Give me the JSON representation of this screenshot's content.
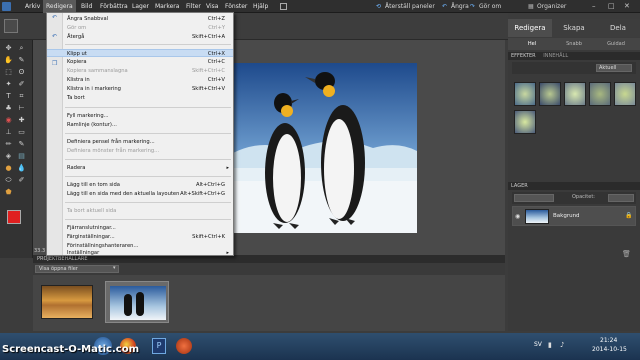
{
  "menubar": {
    "items": [
      "Arkiv",
      "Redigera",
      "Bild",
      "Förbättra",
      "Lager",
      "Markera",
      "Filter",
      "Visa",
      "Fönster",
      "Hjälp"
    ],
    "active_index": 1,
    "reset_panels": "Återställ paneler",
    "undo": "Ångra",
    "redo": "Gör om",
    "organizer": "Organizer"
  },
  "panel_tabs": [
    "Redigera",
    "Skapa",
    "Dela"
  ],
  "sub_tabs": [
    "Hel",
    "Snabb",
    "Guidad"
  ],
  "edit_menu": [
    {
      "label": "Ångra Snabbval",
      "shortcut": "Ctrl+Z",
      "disabled": false
    },
    {
      "label": "Gör om",
      "shortcut": "Ctrl+Y",
      "disabled": true
    },
    {
      "label": "Återgå",
      "shortcut": "Skift+Ctrl+A",
      "disabled": false
    },
    {
      "label": "Klipp ut",
      "shortcut": "Ctrl+X",
      "disabled": false
    },
    {
      "label": "Kopiera",
      "shortcut": "Ctrl+C",
      "disabled": false
    },
    {
      "label": "Kopiera sammanslagna",
      "shortcut": "Skift+Ctrl+C",
      "disabled": true
    },
    {
      "label": "Klistra in",
      "shortcut": "Ctrl+V",
      "disabled": false
    },
    {
      "label": "Klistra in i markering",
      "shortcut": "Skift+Ctrl+V",
      "disabled": false
    },
    {
      "label": "Ta bort",
      "shortcut": "",
      "disabled": false
    },
    {
      "label": "Fyll markering...",
      "shortcut": "",
      "disabled": false
    },
    {
      "label": "Ramlinje (kontur)...",
      "shortcut": "",
      "disabled": false
    },
    {
      "label": "Definiera pensel från markering...",
      "shortcut": "",
      "disabled": false
    },
    {
      "label": "Definiera mönster från markering...",
      "shortcut": "",
      "disabled": true
    },
    {
      "label": "Radera",
      "shortcut": "",
      "disabled": false
    },
    {
      "label": "Lägg till en tom sida",
      "shortcut": "Alt+Ctrl+G",
      "disabled": false
    },
    {
      "label": "Lägg till en sida med den aktuella layouten",
      "shortcut": "Alt+Skift+Ctrl+G",
      "disabled": false
    },
    {
      "label": "Ta bort aktuell sida",
      "shortcut": "",
      "disabled": true
    },
    {
      "label": "Fjärranslutningar...",
      "shortcut": "",
      "disabled": false
    },
    {
      "label": "Färginställningar...",
      "shortcut": "Skift+Ctrl+K",
      "disabled": false
    },
    {
      "label": "Förinställningshanteraren...",
      "shortcut": "",
      "disabled": false
    },
    {
      "label": "Inställningar",
      "shortcut": "",
      "disabled": false
    }
  ],
  "effects_panel": {
    "title": "EFFEKTER",
    "tab2": "INNEHÅLL",
    "dropdown": "Aktuell"
  },
  "layers_panel": {
    "title": "LAGER",
    "opacity_label": "Opacitet:",
    "layer_name": "Bakgrund"
  },
  "project_bin": {
    "title": "PROJEKTBEHÅLLARE",
    "show_label": "Visa öppna filer"
  },
  "zoom": "33.3",
  "taskbar": {
    "time": "21:24",
    "date": "2014-10-15",
    "lang": "SV"
  },
  "watermark": "Screencast-O-Matic.com"
}
